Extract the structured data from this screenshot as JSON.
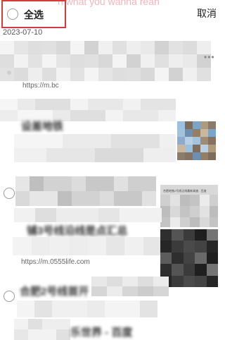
{
  "header": {
    "ghost_text": "n what you wanna rean",
    "select_all_label": "全选",
    "cancel_label": "取消"
  },
  "date": "2023-07-10",
  "items": [
    {
      "url": "https://m.bc",
      "title": ""
    },
    {
      "url": "",
      "title": "设差地铁"
    },
    {
      "url": "",
      "title": ""
    },
    {
      "url": "https://m.0555life.com",
      "title": "铺3号线沿线是点汇总"
    },
    {
      "url": "",
      "title": "合肥2号线首开"
    },
    {
      "url": "",
      "title": "乐世界 - 百度"
    }
  ],
  "thumb_caption": "合肥地铁2号线沿线最新调查 . 百度"
}
